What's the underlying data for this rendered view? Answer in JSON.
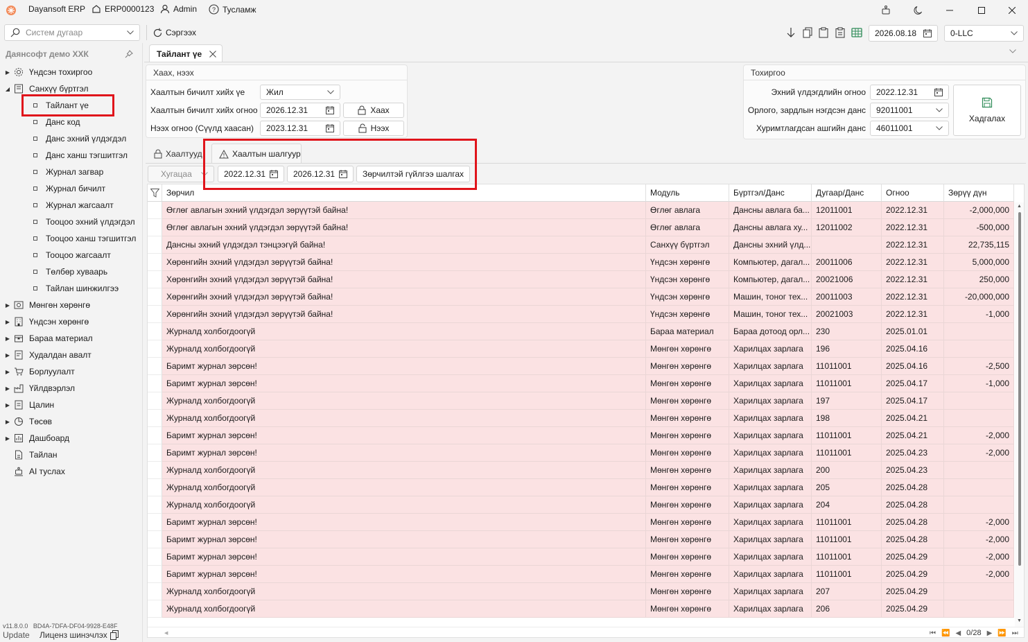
{
  "app": {
    "name": "Dayansoft ERP",
    "erp_code": "ERP0000123",
    "user": "Admin",
    "help": "Тусламж"
  },
  "toolbar": {
    "search_placeholder": "Систем дугаар",
    "refresh_label": "Сэргээх",
    "date": "2026.08.18",
    "company": "0-LLC"
  },
  "sidebar": {
    "org_name": "Даянсофт демо ХХК",
    "items": [
      {
        "label": "Үндсэн тохиргоо",
        "icon": "gear-icon"
      },
      {
        "label": "Санхүү бүртгэл",
        "icon": "ledger-icon"
      },
      {
        "label": "Мөнгөн хөрөнгө",
        "icon": "money-icon"
      },
      {
        "label": "Үндсэн хөрөнгө",
        "icon": "building-icon"
      },
      {
        "label": "Бараа материал",
        "icon": "box-icon"
      },
      {
        "label": "Худалдан авалт",
        "icon": "purchase-icon"
      },
      {
        "label": "Борлуулалт",
        "icon": "cart-icon"
      },
      {
        "label": "Үйлдвэрлэл",
        "icon": "factory-icon"
      },
      {
        "label": "Цалин",
        "icon": "salary-icon"
      },
      {
        "label": "Төсөв",
        "icon": "pie-icon"
      },
      {
        "label": "Дашбоард",
        "icon": "dashboard-icon"
      },
      {
        "label": "Тайлан",
        "icon": "report-icon"
      },
      {
        "label": "AI туслах",
        "icon": "assistant-icon"
      }
    ],
    "sub_items": [
      "Тайлант үе",
      "Данс код",
      "Данс эхний үлдэгдэл",
      "Данс ханш тэгшитгэл",
      "Журнал загвар",
      "Журнал бичилт",
      "Журнал жагсаалт",
      "Тооцоо эхний үлдэгдэл",
      "Тооцоо ханш тэгшитгэл",
      "Тооцоо жагсаалт",
      "Төлбөр хуваарь",
      "Тайлан шинжилгээ"
    ],
    "version": "v11.8.0.0",
    "machine_id": "BD4A-7DFA-DF04-9928-E48F",
    "update_label": "Update",
    "license_label": "Лиценз шинэчлэх"
  },
  "tab": {
    "title": "Тайлант үе"
  },
  "close_panel": {
    "title": "Хаах, нээх",
    "row1_label": "Хаалтын бичилт хийх үе",
    "row1_value": "Жил",
    "row2_label": "Хаалтын бичилт хийх огноо",
    "row2_value": "2026.12.31",
    "row2_button": "Хаах",
    "row3_label": "Нээх огноо (Сүүлд хаасан)",
    "row3_value": "2023.12.31",
    "row3_button": "Нээх"
  },
  "settings_panel": {
    "title": "Тохиргоо",
    "row1_label": "Эхний үлдэгдлийн огноо",
    "row1_value": "2022.12.31",
    "row2_label": "Орлого, зардлын нэгдсэн данс",
    "row2_value": "92011001",
    "row3_label": "Хуримтлагдсан ашгийн данс",
    "row3_value": "46011001",
    "save_label": "Хадгалах"
  },
  "subtabs": {
    "closings": "Хаалтууд",
    "checks": "Хаалтын шалгуур"
  },
  "filter": {
    "period_placeholder": "Хугацаа",
    "date_from": "2022.12.31",
    "date_to": "2026.12.31",
    "check_button": "Зөрчилтэй гүйлгээ шалгах"
  },
  "grid": {
    "columns": [
      "Зөрчил",
      "Модуль",
      "Бүртгэл/Данс",
      "Дугаар/Данс",
      "Огноо",
      "Зөрүү дүн"
    ],
    "rows": [
      [
        "Өглөг авлагын эхний үлдэгдэл зөрүүтэй байна!",
        "Өглөг авлага",
        "Дансны авлага ба...",
        "12011001",
        "2022.12.31",
        "-2,000,000"
      ],
      [
        "Өглөг авлагын эхний үлдэгдэл зөрүүтэй байна!",
        "Өглөг авлага",
        "Дансны авлага ху...",
        "12011002",
        "2022.12.31",
        "-500,000"
      ],
      [
        "Дансны эхний үлдэгдэл тэнцээгүй байна!",
        "Санхүү бүртгэл",
        "Дансны эхний үлд...",
        "",
        "2022.12.31",
        "22,735,115"
      ],
      [
        "Хөрөнгийн эхний үлдэгдэл зөрүүтэй байна!",
        "Үндсэн хөрөнгө",
        "Компьютер, дагал...",
        "20011006",
        "2022.12.31",
        "5,000,000"
      ],
      [
        "Хөрөнгийн эхний үлдэгдэл зөрүүтэй байна!",
        "Үндсэн хөрөнгө",
        "Компьютер, дагал...",
        "20021006",
        "2022.12.31",
        "250,000"
      ],
      [
        "Хөрөнгийн эхний үлдэгдэл зөрүүтэй байна!",
        "Үндсэн хөрөнгө",
        "Машин, тоног тех...",
        "20011003",
        "2022.12.31",
        "-20,000,000"
      ],
      [
        "Хөрөнгийн эхний үлдэгдэл зөрүүтэй байна!",
        "Үндсэн хөрөнгө",
        "Машин, тоног тех...",
        "20021003",
        "2022.12.31",
        "-1,000"
      ],
      [
        "Журналд холбогдоогүй",
        "Бараа материал",
        "Бараа дотоод орл...",
        "230",
        "2025.01.01",
        ""
      ],
      [
        "Журналд холбогдоогүй",
        "Мөнгөн хөрөнгө",
        "Харилцах зарлага",
        "196",
        "2025.04.16",
        ""
      ],
      [
        "Баримт журнал зөрсөн!",
        "Мөнгөн хөрөнгө",
        "Харилцах зарлага",
        "11011001",
        "2025.04.16",
        "-2,500"
      ],
      [
        "Баримт журнал зөрсөн!",
        "Мөнгөн хөрөнгө",
        "Харилцах зарлага",
        "11011001",
        "2025.04.17",
        "-1,000"
      ],
      [
        "Журналд холбогдоогүй",
        "Мөнгөн хөрөнгө",
        "Харилцах зарлага",
        "197",
        "2025.04.17",
        ""
      ],
      [
        "Журналд холбогдоогүй",
        "Мөнгөн хөрөнгө",
        "Харилцах зарлага",
        "198",
        "2025.04.21",
        ""
      ],
      [
        "Баримт журнал зөрсөн!",
        "Мөнгөн хөрөнгө",
        "Харилцах зарлага",
        "11011001",
        "2025.04.21",
        "-2,000"
      ],
      [
        "Баримт журнал зөрсөн!",
        "Мөнгөн хөрөнгө",
        "Харилцах зарлага",
        "11011001",
        "2025.04.23",
        "-2,000"
      ],
      [
        "Журналд холбогдоогүй",
        "Мөнгөн хөрөнгө",
        "Харилцах зарлага",
        "200",
        "2025.04.23",
        ""
      ],
      [
        "Журналд холбогдоогүй",
        "Мөнгөн хөрөнгө",
        "Харилцах зарлага",
        "205",
        "2025.04.28",
        ""
      ],
      [
        "Журналд холбогдоогүй",
        "Мөнгөн хөрөнгө",
        "Харилцах зарлага",
        "204",
        "2025.04.28",
        ""
      ],
      [
        "Баримт журнал зөрсөн!",
        "Мөнгөн хөрөнгө",
        "Харилцах зарлага",
        "11011001",
        "2025.04.28",
        "-2,000"
      ],
      [
        "Баримт журнал зөрсөн!",
        "Мөнгөн хөрөнгө",
        "Харилцах зарлага",
        "11011001",
        "2025.04.28",
        "-2,000"
      ],
      [
        "Баримт журнал зөрсөн!",
        "Мөнгөн хөрөнгө",
        "Харилцах зарлага",
        "11011001",
        "2025.04.29",
        "-2,000"
      ],
      [
        "Баримт журнал зөрсөн!",
        "Мөнгөн хөрөнгө",
        "Харилцах зарлага",
        "11011001",
        "2025.04.29",
        "-2,000"
      ],
      [
        "Журналд холбогдоогүй",
        "Мөнгөн хөрөнгө",
        "Харилцах зарлага",
        "207",
        "2025.04.29",
        ""
      ],
      [
        "Журналд холбогдоогүй",
        "Мөнгөн хөрөнгө",
        "Харилцах зарлага",
        "206",
        "2025.04.29",
        ""
      ]
    ],
    "pager": "0/28"
  },
  "colors": {
    "accent": "#e0141b",
    "row_error": "#fbe2e3",
    "save_icon": "#2e8b57"
  }
}
